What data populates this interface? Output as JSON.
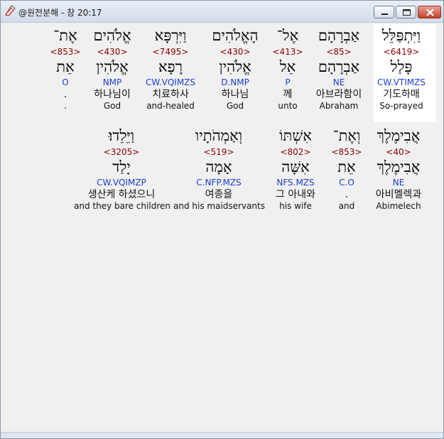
{
  "window": {
    "title": "@원전분해 - 창 20:17"
  },
  "rows": [
    [
      {
        "heb": "וַיִּתְפַּלֵּל",
        "strong": "<6419>",
        "lemma": "פָּלַל",
        "morph": "CW.VTIMZS",
        "kor": "기도하매",
        "eng": "So-prayed"
      },
      {
        "heb": "אַבְרָהָם",
        "strong": "<85>",
        "lemma": "אַבְרָהָם",
        "morph": "NE",
        "kor": "아브라함이",
        "eng": "Abraham"
      },
      {
        "heb": "אֶל־",
        "strong": "<413>",
        "lemma": "אֵל",
        "morph": "P",
        "kor": "께",
        "eng": "unto"
      },
      {
        "heb": "הָאֱלֹהִים",
        "strong": "<430>",
        "lemma": "אֱלֹהִין",
        "morph": "D.NMP",
        "kor": "하나님",
        "eng": "God"
      },
      {
        "heb": "וַיִּרְפָּא",
        "strong": "<7495>",
        "lemma": "רָפָא",
        "morph": "CW.VQIMZS",
        "kor": "치료하사",
        "eng": "and-healed"
      },
      {
        "heb": "אֱלֹהִים",
        "strong": "<430>",
        "lemma": "אֱלֹהִין",
        "morph": "NMP",
        "kor": "하나님이",
        "eng": "God"
      },
      {
        "heb": "אֶת־",
        "strong": "<853>",
        "lemma": "אֵת",
        "morph": "O",
        "kor": ".",
        "eng": "."
      }
    ],
    [
      {
        "heb": "אֲבִימֶלֶךְ",
        "strong": "<40>",
        "lemma": "אֲבִימֶלֶךְ",
        "morph": "NE",
        "kor": "아비멜렉과",
        "eng": "Abimelech"
      },
      {
        "heb": "וְאֶת־",
        "strong": "<853>",
        "lemma": "אֵת",
        "morph": "C.O",
        "kor": ".",
        "eng": "and"
      },
      {
        "heb": "אִשְׁתּוֹ",
        "strong": "<802>",
        "lemma": "אִשָּׁה",
        "morph": "NFS.MZS",
        "kor": "그 아내와",
        "eng": "his wife"
      },
      {
        "heb": "וְאַמְהֹתָיו",
        "strong": "<519>",
        "lemma": "אָמָה",
        "morph": "C.NFP.MZS",
        "kor": "여종을",
        "eng": "and his maidservants"
      },
      {
        "heb": "וַיֵּלֵדוּ׃",
        "strong": "<3205>",
        "lemma": "יָלַד",
        "morph": "CW.VQIMZP",
        "kor": "생산케 하셨으니",
        "eng": "and they bare children"
      }
    ]
  ]
}
